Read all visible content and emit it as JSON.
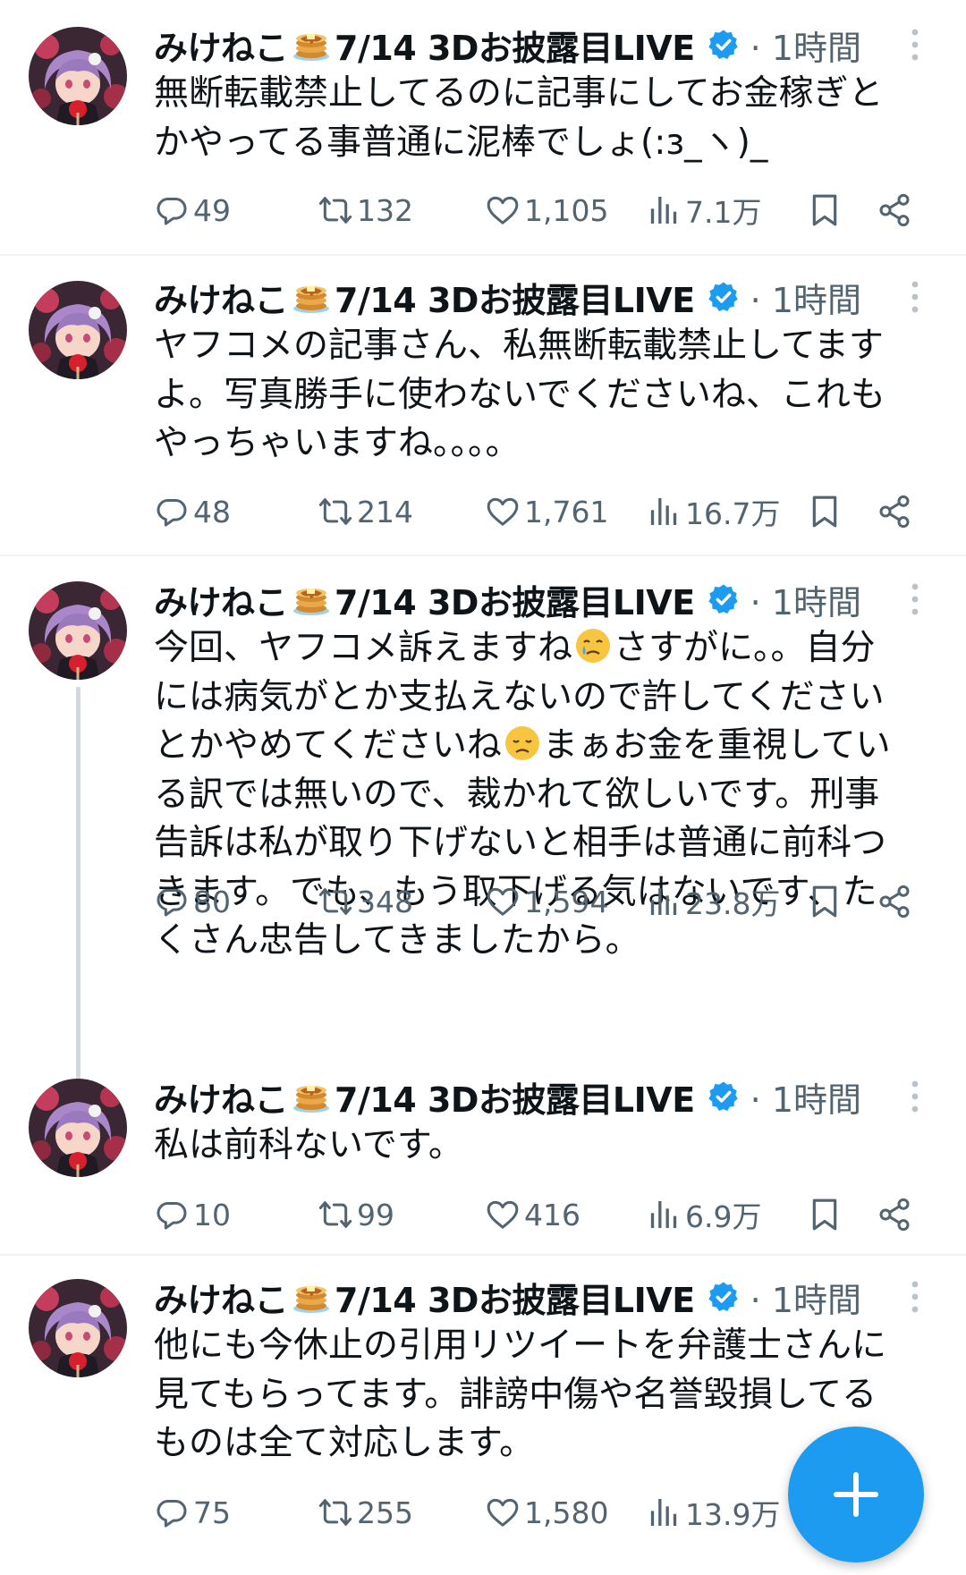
{
  "author": {
    "name_part1": "みけねこ",
    "name_part2": "7/14 3Dお披露目LIVE",
    "time": "· 1時間",
    "icons": [
      "pancake-emoji",
      "verified-badge-icon",
      "more-icon"
    ]
  },
  "tweets": [
    {
      "text": "無断転載禁止してるのに記事にしてお金稼ぎと\nかやってる事普通に泥棒でしょ(:з_ヽ)_",
      "replies": "49",
      "retweets": "132",
      "likes": "1,105",
      "views": "7.1万"
    },
    {
      "text": "ヤフコメの記事さん、私無断転載禁止してます\nよ。写真勝手に使わないでくださいね、これも\nやっちゃいますね。。。。",
      "replies": "48",
      "retweets": "214",
      "likes": "1,761",
      "views": "16.7万"
    },
    {
      "text_parts": [
        "今回、ヤフコメ訴えますね",
        "さすがに。。自分\nには病気がとか支払えないので許してください\nとかやめてくださいね",
        "まぁお金を重視してい\nる訳では無いので、裁かれて欲しいです。刑事\n告訴は私が取り下げないと相手は普通に前科つ\nきます。でも、もう取下げる気はないです、た\nくさん忠告してきましたから。"
      ],
      "replies": "80",
      "retweets": "348",
      "likes": "1,594",
      "views": "23.8万"
    },
    {
      "text": "私は前科ないです。",
      "replies": "10",
      "retweets": "99",
      "likes": "416",
      "views": "6.9万"
    },
    {
      "text": "他にも今休止の引用リツイートを弁護士さんに\n見てもらってます。誹謗中傷や名誉毀損してる\nものは全て対応します。",
      "replies": "75",
      "retweets": "255",
      "likes": "1,580",
      "views": "13.9万"
    }
  ],
  "colors": {
    "text": "#0f1419",
    "secondary": "#536471",
    "accent": "#1d9bf0",
    "separator": "#eff3f4",
    "thread_line": "#cfd9de"
  },
  "fab": {
    "icon": "plus-icon"
  }
}
